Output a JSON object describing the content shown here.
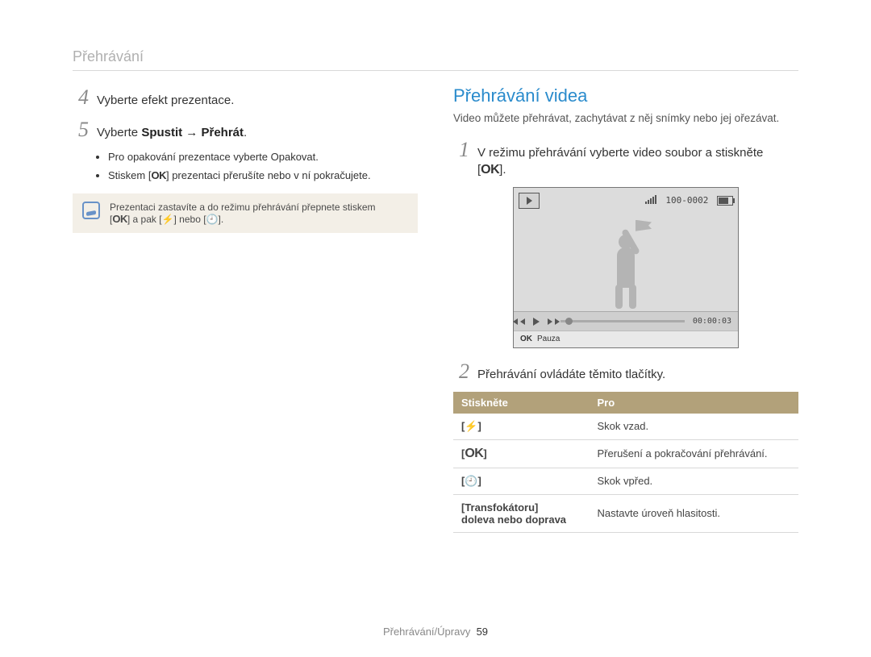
{
  "header": {
    "title": "Přehrávání"
  },
  "left": {
    "step4": {
      "num": "4",
      "text": "Vyberte efekt prezentace."
    },
    "step5": {
      "num": "5",
      "prefix": "Vyberte ",
      "bold": "Spustit → Přehrát",
      "suffix": "."
    },
    "bullets": {
      "b1_before": "Pro opakování prezentace vyberte ",
      "b1_bold": "Opakovat",
      "b1_after": ".",
      "b2_before": "Stiskem [",
      "b2_ok": "OK",
      "b2_after": "] prezentaci přerušíte nebo v ní pokračujete."
    },
    "note": {
      "line1": "Prezentaci zastavíte a do režimu přehrávání přepnete stiskem",
      "line2_a": "[",
      "line2_ok": "OK",
      "line2_b": "] a pak [",
      "line2_flash": "⚡",
      "line2_c": "] nebo [",
      "line2_timer": "🕘",
      "line2_d": "]."
    }
  },
  "right": {
    "title": "Přehrávání videa",
    "intro": "Video můžete přehrávat, zachytávat z něj snímky nebo jej ořezávat.",
    "step1": {
      "num": "1",
      "before": "V režimu přehrávání vyberte video soubor a stiskněte",
      "bracket_open": "[",
      "ok": "OK",
      "bracket_close": "]."
    },
    "video": {
      "counter_label": "100-0002",
      "time": "00:00:03",
      "footer_ok": "OK",
      "footer_text": "Pauza"
    },
    "step2": {
      "num": "2",
      "text": "Přehrávání ovládáte těmito tlačítky."
    },
    "table": {
      "h1": "Stiskněte",
      "h2": "Pro",
      "rows": [
        {
          "key_open": "[",
          "key_sym": "⚡",
          "key_close": "]",
          "desc": "Skok vzad."
        },
        {
          "key_open": "[",
          "key_sym": "OK",
          "key_close": "]",
          "desc": "Přerušení a pokračování přehrávání."
        },
        {
          "key_open": "[",
          "key_sym": "🕘",
          "key_close": "]",
          "desc": "Skok vpřed."
        },
        {
          "key_zoom_l1": "[Transfokátoru]",
          "key_zoom_l2": "doleva nebo doprava",
          "desc": "Nastavte úroveň hlasitosti."
        }
      ]
    }
  },
  "footer": {
    "text": "Přehrávání/Úpravy",
    "page": "59"
  }
}
